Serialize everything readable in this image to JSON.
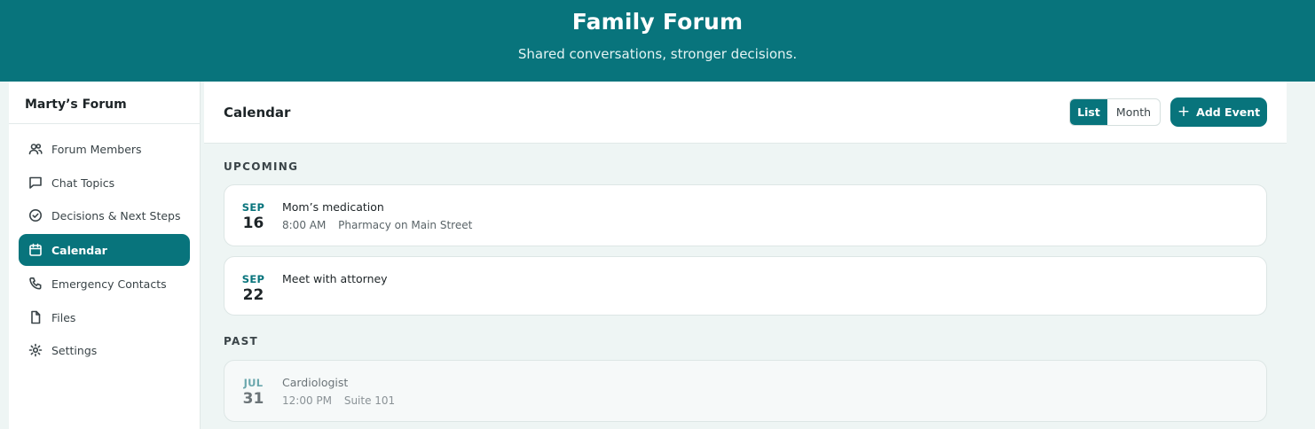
{
  "header": {
    "title": "Family Forum",
    "subtitle": "Shared conversations, stronger decisions."
  },
  "sidebar": {
    "forum_name": "Marty’s Forum",
    "items": [
      {
        "label": "Forum Members",
        "icon": "users-icon"
      },
      {
        "label": "Chat Topics",
        "icon": "chat-bubble-icon"
      },
      {
        "label": "Decisions & Next Steps",
        "icon": "check-circle-icon"
      },
      {
        "label": "Calendar",
        "icon": "calendar-icon",
        "active": true
      },
      {
        "label": "Emergency Contacts",
        "icon": "phone-icon"
      },
      {
        "label": "Files",
        "icon": "file-icon"
      },
      {
        "label": "Settings",
        "icon": "gear-icon"
      }
    ]
  },
  "main": {
    "title": "Calendar",
    "view_toggle": {
      "list": "List",
      "month": "Month",
      "selected": "List"
    },
    "add_button": {
      "label": "Add Event",
      "icon": "plus-icon"
    },
    "upcoming_label": "UPCOMING",
    "past_label": "PAST",
    "upcoming": [
      {
        "month": "SEP",
        "day": "16",
        "title": "Mom’s medication",
        "time": "8:00 AM",
        "location": "Pharmacy on Main Street"
      },
      {
        "month": "SEP",
        "day": "22",
        "title": "Meet with attorney",
        "time": "",
        "location": ""
      }
    ],
    "past": [
      {
        "month": "JUL",
        "day": "31",
        "title": "Cardiologist",
        "time": "12:00 PM",
        "location": "Suite 101"
      }
    ]
  },
  "colors": {
    "brand": "#08747c",
    "background": "#eef5f4",
    "card": "#ffffff"
  }
}
